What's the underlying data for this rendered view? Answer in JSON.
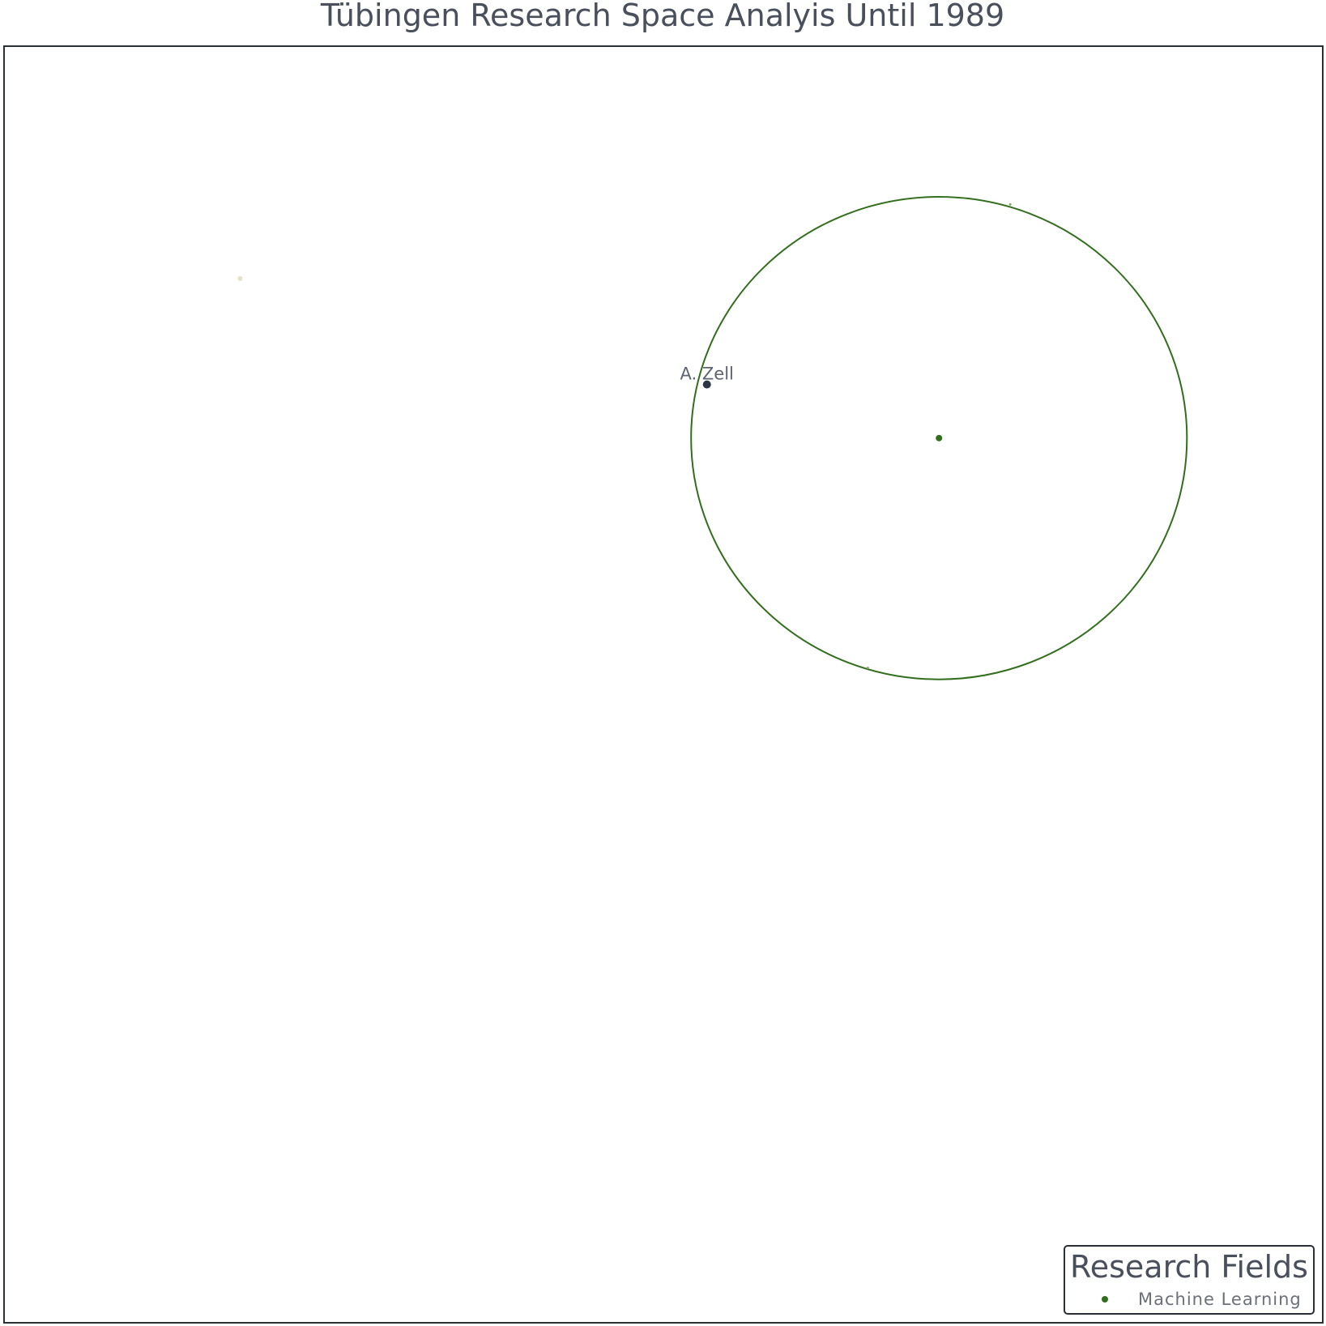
{
  "chart_data": {
    "type": "scatter",
    "title": "Tübingen Research Space Analyis Until 1989",
    "xlim": [
      0,
      100
    ],
    "ylim": [
      0,
      100
    ],
    "grid": false,
    "legend_placement": "bottom-right",
    "legend": {
      "title": "Research Fields",
      "entries": [
        {
          "label": "Machine Learning",
          "color": "#336e1e"
        }
      ]
    },
    "fields": [
      {
        "name": "Machine Learning",
        "color": "#336e1e",
        "center": [
          70.9,
          69.3
        ],
        "radius_x": 18.8,
        "radius_y": 18.9
      }
    ],
    "points": [
      {
        "label": "A. Zell",
        "x": 53.3,
        "y": 73.5,
        "color": "#2e3542",
        "size": "large"
      },
      {
        "label": "",
        "x": 17.9,
        "y": 81.8,
        "color": "#e6e1c8",
        "size": "small"
      },
      {
        "label": "",
        "x": 76.3,
        "y": 87.6,
        "color": "#7fa86a",
        "size": "tiny"
      },
      {
        "label": "",
        "x": 65.5,
        "y": 51.3,
        "color": "#7fa86a",
        "size": "tiny"
      }
    ]
  }
}
